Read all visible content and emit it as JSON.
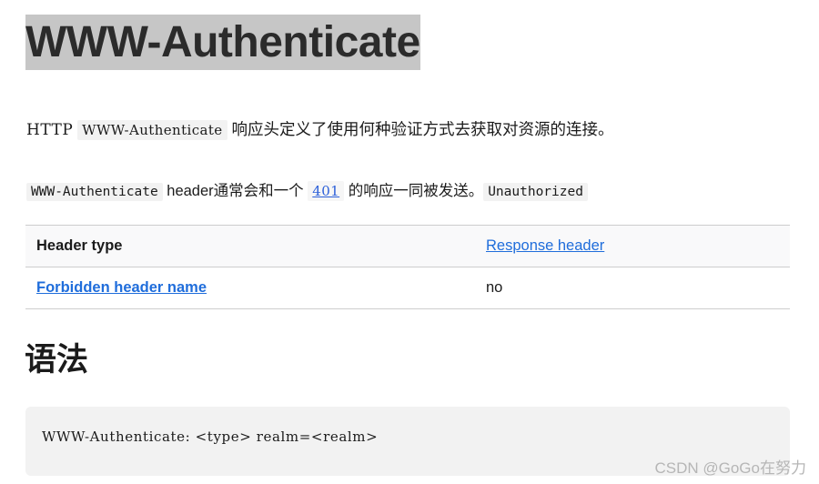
{
  "page": {
    "title": "WWW-Authenticate",
    "title_highlighted": true,
    "background_color": "#ffffff",
    "text_color": "#1b1b1b",
    "highlight_color": "#c6c6c6",
    "link_color": "#1f6ddb"
  },
  "intro": {
    "prefix": "HTTP",
    "code": "WWW-Authenticate",
    "suffix": "响应头定义了使用何种验证方式去获取对资源的连接。"
  },
  "note": {
    "code": "WWW-Authenticate",
    "text_before_link": "header通常会和一个",
    "link_label": "401",
    "text_after_link": "的响应一同被发送。",
    "trailing_code": "Unauthorized"
  },
  "table": {
    "rows": [
      {
        "label": "Header type",
        "label_is_link": false,
        "value": "Response header",
        "value_is_link": true
      },
      {
        "label": "Forbidden header name",
        "label_is_link": true,
        "value": "no",
        "value_is_link": false
      }
    ]
  },
  "syntax": {
    "heading": "语法",
    "code": "WWW-Authenticate: <type> realm=<realm>"
  },
  "watermark": {
    "text": "CSDN @GoGo在努力"
  }
}
